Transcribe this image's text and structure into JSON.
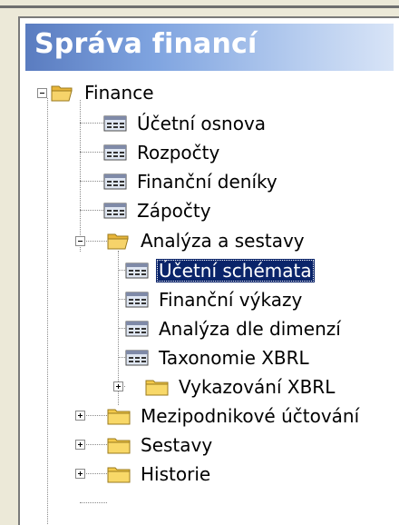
{
  "panel": {
    "title": "Správa financí"
  },
  "tree": {
    "root": {
      "label": "Finance",
      "icon": "open-folder-icon",
      "state": "expanded"
    },
    "items": [
      {
        "label": "Účetní osnova",
        "icon": "list-form-icon"
      },
      {
        "label": "Rozpočty",
        "icon": "list-form-icon"
      },
      {
        "label": "Finanční deníky",
        "icon": "list-form-icon"
      },
      {
        "label": "Zápočty",
        "icon": "list-form-icon"
      },
      {
        "label": "Analýza a sestavy",
        "icon": "open-folder-icon",
        "state": "expanded"
      },
      {
        "label": "Účetní schémata",
        "icon": "list-form-icon",
        "selected": true
      },
      {
        "label": "Finanční výkazy",
        "icon": "list-form-icon"
      },
      {
        "label": "Analýza dle dimenzí",
        "icon": "list-form-icon"
      },
      {
        "label": "Taxonomie XBRL",
        "icon": "list-form-icon"
      },
      {
        "label": "Vykazování XBRL",
        "icon": "closed-folder-icon",
        "state": "collapsed"
      },
      {
        "label": "Mezipodnikové účtování",
        "icon": "closed-folder-icon",
        "state": "collapsed"
      },
      {
        "label": "Sestavy",
        "icon": "closed-folder-icon",
        "state": "collapsed"
      },
      {
        "label": "Historie",
        "icon": "closed-folder-icon",
        "state": "collapsed"
      }
    ]
  },
  "colors": {
    "selection": "#0a246a",
    "title_gradient_start": "#5a7cc0",
    "title_gradient_end": "#d8e4f7",
    "folder": "#f3c94a"
  }
}
